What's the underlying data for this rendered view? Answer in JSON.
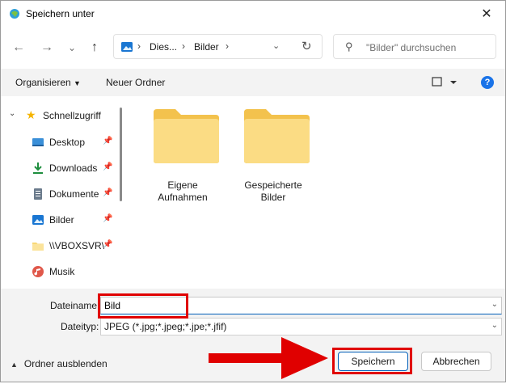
{
  "window": {
    "title": "Speichern unter",
    "close_glyph": "✕"
  },
  "nav": {
    "back_glyph": "←",
    "forward_glyph": "→",
    "recent_glyph": "⌄",
    "up_glyph": "↑",
    "address": {
      "crumbs": [
        "Dies...",
        "Bilder"
      ],
      "sep": "›"
    },
    "search_placeholder": "\"Bilder\" durchsuchen"
  },
  "commandbar": {
    "organize_label": "Organisieren",
    "new_folder_label": "Neuer Ordner",
    "help_glyph": "?"
  },
  "sidebar": {
    "quick_access": "Schnellzugriff",
    "items": [
      {
        "label": "Desktop",
        "icon": "desktop-icon"
      },
      {
        "label": "Downloads",
        "icon": "download-icon"
      },
      {
        "label": "Dokumente",
        "icon": "document-icon"
      },
      {
        "label": "Bilder",
        "icon": "pictures-icon"
      },
      {
        "label": "\\\\VBOXSVR\\",
        "icon": "folder-icon"
      },
      {
        "label": "Musik",
        "icon": "music-icon"
      }
    ]
  },
  "folders": [
    {
      "line1": "Eigene",
      "line2": "Aufnahmen"
    },
    {
      "line1": "Gespeicherte",
      "line2": "Bilder"
    }
  ],
  "form": {
    "filename_label": "Dateiname:",
    "filename_value": "Bild",
    "filetype_label": "Dateityp:",
    "filetype_value": "JPEG (*.jpg;*.jpeg;*.jpe;*.jfif)"
  },
  "footer": {
    "hide_folders_label": "Ordner ausblenden",
    "save_label": "Speichern",
    "cancel_label": "Abbrechen"
  },
  "colors": {
    "accent": "#005fb8",
    "highlight_red": "#e00000",
    "folder_yellow": "#f8d775"
  }
}
